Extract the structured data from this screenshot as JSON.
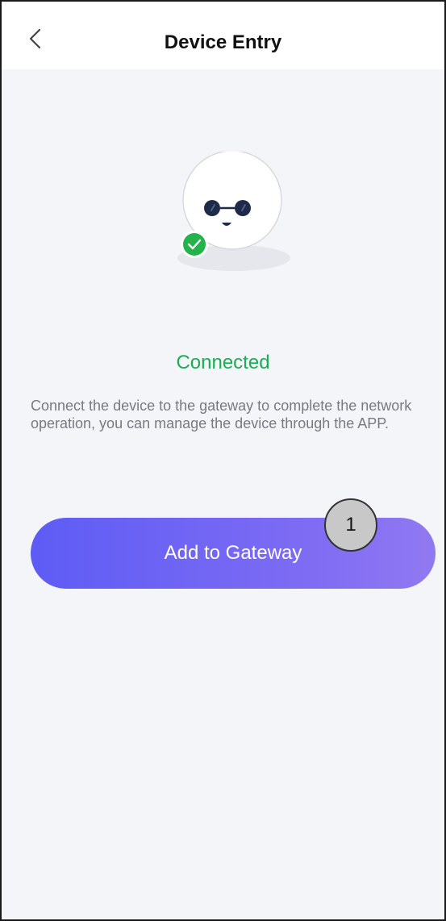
{
  "header": {
    "title": "Device Entry",
    "back_icon": "chevron-left-icon"
  },
  "illustration": {
    "icon": "robot-face-icon",
    "badge_icon": "check-circle-icon",
    "badge_color": "#22b34a"
  },
  "status": {
    "text": "Connected",
    "color": "#1aad52"
  },
  "description": "Connect the device to the gateway to complete the network operation, you can manage the device through the APP.",
  "primary_button": {
    "label": "Add to Gateway",
    "gradient_start": "#5e5cf5",
    "gradient_end": "#9179f1"
  },
  "annotation": {
    "number": "1"
  }
}
